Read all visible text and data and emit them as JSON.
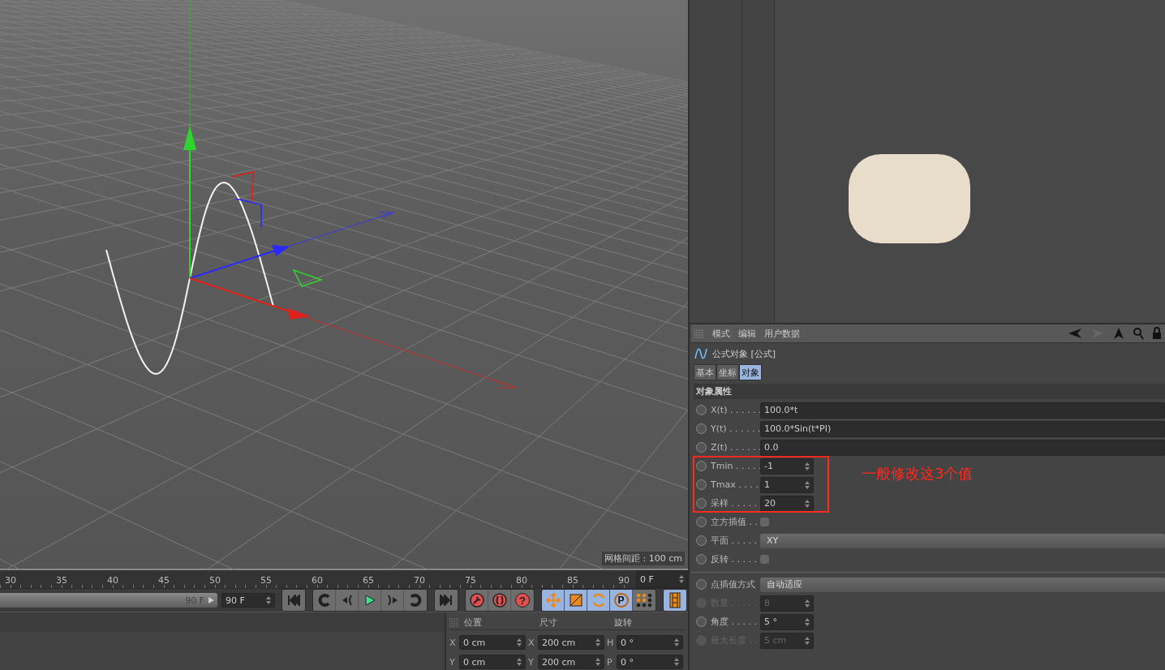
{
  "viewport": {
    "grid_spacing": "网格间距 : 100 cm"
  },
  "timeline": {
    "range": {
      "level": 1
    },
    "ticks": [
      "30",
      "35",
      "40",
      "45",
      "50",
      "55",
      "60",
      "65",
      "70",
      "75",
      "80",
      "85",
      "90"
    ],
    "current_frame": "0 F",
    "range_end": "90 F",
    "end_frame": "90 F"
  },
  "transport_groups": [
    {
      "buttons": [
        {
          "kind": "first",
          "on": false
        }
      ]
    },
    {
      "buttons": [
        {
          "kind": "prev-key",
          "on": false
        },
        {
          "kind": "prev-frame",
          "on": false
        },
        {
          "kind": "play",
          "on": false
        },
        {
          "kind": "next-frame",
          "on": false
        },
        {
          "kind": "next-key",
          "on": false
        }
      ]
    },
    {
      "buttons": [
        {
          "kind": "last",
          "on": false
        }
      ]
    },
    {
      "buttons": [
        {
          "kind": "record",
          "on": false
        },
        {
          "kind": "autokey",
          "on": false
        },
        {
          "kind": "help",
          "label": "?",
          "on": false
        }
      ]
    },
    {
      "buttons": [
        {
          "kind": "move",
          "on": true
        },
        {
          "kind": "scale",
          "on": true
        },
        {
          "kind": "rotate",
          "on": true
        },
        {
          "kind": "param",
          "label": "P",
          "on": true
        },
        {
          "kind": "points",
          "on": false
        }
      ]
    },
    {
      "buttons": [
        {
          "kind": "film",
          "on": true
        }
      ]
    }
  ],
  "coordinates": {
    "headers": [
      "位置",
      "尺寸",
      "旋转"
    ],
    "rows": [
      {
        "labels": [
          "X",
          "X",
          "H"
        ],
        "values": [
          "0 cm",
          "200 cm",
          "0 °"
        ]
      },
      {
        "labels": [
          "Y",
          "Y",
          "P"
        ],
        "values": [
          "0 cm",
          "200 cm",
          "0 °"
        ]
      }
    ]
  },
  "attributes": {
    "menu": [
      "模式",
      "编辑",
      "用户数据"
    ],
    "object_title": "公式对象 [公式]",
    "tabs": [
      {
        "label": "基本",
        "selected": false
      },
      {
        "label": "坐标",
        "selected": false
      },
      {
        "label": "对象",
        "selected": true
      }
    ],
    "section": "对象属性",
    "groups": [
      [
        {
          "kind": "text",
          "label": "X(t) . . . . . .",
          "value": "100.0*t",
          "disabled": false
        },
        {
          "kind": "text",
          "label": "Y(t) . . . . . .",
          "value": "100.0*Sin(t*PI)",
          "disabled": false
        },
        {
          "kind": "text",
          "label": "Z(t) . . . . . .",
          "value": "0.0",
          "disabled": false
        },
        {
          "kind": "spinner",
          "label": "Tmin . . . . .",
          "value": "-1",
          "disabled": false
        },
        {
          "kind": "spinner",
          "label": "Tmax . . . .",
          "value": "1",
          "disabled": false
        },
        {
          "kind": "spinner",
          "label": "采样 . . . . .",
          "value": "20",
          "disabled": false
        },
        {
          "kind": "checkbox",
          "label": "立方插值 . .",
          "checked": false,
          "disabled": false
        },
        {
          "kind": "dropdown",
          "label": "平面 . . . . .",
          "value": "XY",
          "disabled": false
        },
        {
          "kind": "checkbox",
          "label": "反转 . . . . .",
          "checked": false,
          "disabled": false
        }
      ],
      [
        {
          "kind": "dropdown",
          "label": "点插值方式",
          "value": "自动适应",
          "disabled": false
        },
        {
          "kind": "spinner",
          "label": "数量 . . . . .",
          "value": "8",
          "disabled": true
        },
        {
          "kind": "spinner",
          "label": "角度 . . . . .",
          "value": "5 °",
          "disabled": false
        },
        {
          "kind": "spinner",
          "label": "最大长度 . .",
          "value": "5 cm",
          "disabled": true
        }
      ]
    ],
    "annotation": "一般修改这3个值"
  }
}
